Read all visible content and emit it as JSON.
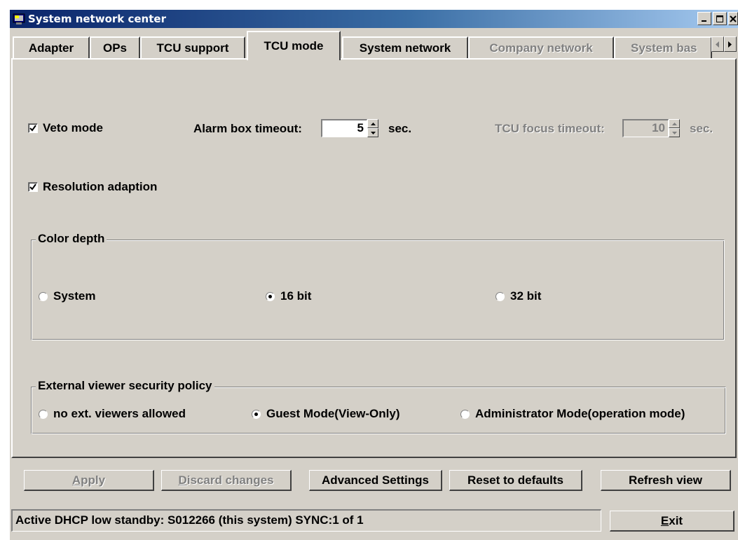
{
  "window": {
    "title": "System network center",
    "title_buttons": [
      "minimize",
      "maximize",
      "close"
    ]
  },
  "tabs": [
    {
      "label": "Adapter",
      "state": "normal"
    },
    {
      "label": "OPs",
      "state": "normal"
    },
    {
      "label": "TCU support",
      "state": "normal"
    },
    {
      "label": "TCU mode",
      "state": "active"
    },
    {
      "label": "System network",
      "state": "normal"
    },
    {
      "label": "Company network",
      "state": "disabled"
    },
    {
      "label": "System bas",
      "state": "disabled"
    }
  ],
  "tcu_mode": {
    "veto_mode": {
      "label": "Veto mode",
      "checked": true
    },
    "alarm_box_timeout": {
      "label": "Alarm box timeout:",
      "value": "5",
      "unit": "sec."
    },
    "tcu_focus_timeout": {
      "label": "TCU focus timeout:",
      "value": "10",
      "unit": "sec.",
      "enabled": false
    },
    "resolution_adaption": {
      "label": "Resolution adaption",
      "checked": true
    },
    "color_depth": {
      "legend": "Color depth",
      "options": [
        {
          "label": "System",
          "selected": false
        },
        {
          "label": "16 bit",
          "selected": true
        },
        {
          "label": "32 bit",
          "selected": false
        }
      ]
    },
    "security_policy": {
      "legend": "External viewer security policy",
      "options": [
        {
          "label": "no ext. viewers allowed",
          "selected": false
        },
        {
          "label": "Guest Mode(View-Only)",
          "selected": true
        },
        {
          "label": "Administrator Mode(operation mode)",
          "selected": false
        }
      ]
    }
  },
  "buttons": {
    "apply": "Apply",
    "apply_mnemonic": "A",
    "apply_rest": "pply",
    "discard": "Discard changes",
    "discard_mnemonic": "D",
    "discard_rest": "iscard changes",
    "advanced": "Advanced Settings",
    "reset": "Reset to defaults",
    "refresh": "Refresh view",
    "exit": "Exit",
    "exit_mnemonic": "E",
    "exit_rest": "xit"
  },
  "status": {
    "text": "Active DHCP low standby: S012266 (this system) SYNC:1 of 1"
  },
  "colors": {
    "face": "#d4d0c8",
    "title_start": "#0a246a",
    "title_end": "#a6caf0",
    "disabled_text": "#808080"
  }
}
